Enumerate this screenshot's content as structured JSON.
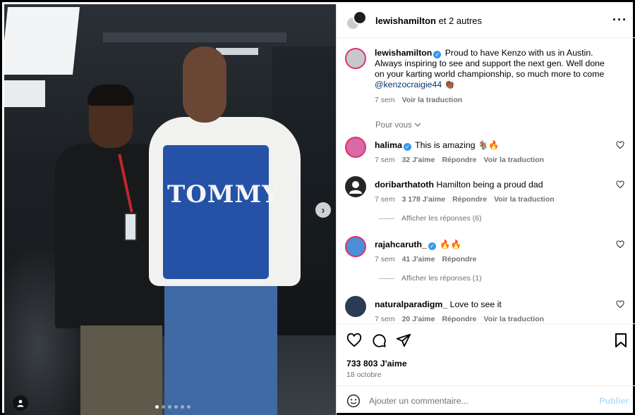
{
  "header": {
    "username": "lewishamilton",
    "others": "et 2 autres",
    "more_icon": "more-horizontal-icon"
  },
  "caption": {
    "username": "lewishamilton",
    "text": "Proud to have Kenzo with us in Austin. Always inspiring to see and support the next gen. Well done on your karting world championship, so much more to come",
    "mention": "@kenzocraigie44",
    "emoji": "👏🏾",
    "time": "7 sem",
    "translate": "Voir la traduction"
  },
  "for_you": "Pour vous",
  "comments": [
    {
      "user": "halima",
      "verified": true,
      "text": "This is amazing 🐐🔥",
      "time": "7 sem",
      "likes": "32 J'aime",
      "reply": "Répondre",
      "translate": "Voir la traduction",
      "avatar_color": "#d86aa6"
    },
    {
      "user": "doribarthatoth",
      "verified": false,
      "text": "Hamilton being a proud dad",
      "time": "7 sem",
      "likes": "3 178 J'aime",
      "reply": "Répondre",
      "translate": "Voir la traduction",
      "avatar_color": "#262626",
      "view_replies": "Afficher les réponses (6)"
    },
    {
      "user": "rajahcaruth_",
      "verified": true,
      "text": "🔥🔥",
      "time": "7 sem",
      "likes": "41 J'aime",
      "reply": "Répondre",
      "translate": "",
      "avatar_color": "#4a8fd8",
      "view_replies": "Afficher les réponses (1)"
    },
    {
      "user": "naturalparadigm_",
      "verified": false,
      "text": "Love to see it",
      "time": "7 sem",
      "likes": "20 J'aime",
      "reply": "Répondre",
      "translate": "Voir la traduction",
      "avatar_color": "#2b3a55"
    }
  ],
  "post": {
    "likes": "733 803 J'aime",
    "date": "18 octobre"
  },
  "composer": {
    "placeholder": "Ajouter un commentaire...",
    "publish": "Publier"
  },
  "photo": {
    "sweatshirt_text": "TOMMY",
    "carousel_total": 6,
    "carousel_active": 1
  },
  "colors": {
    "verified": "#3897f0",
    "link": "#00376b",
    "muted": "#737373",
    "publish_disabled": "#b2dffc"
  }
}
